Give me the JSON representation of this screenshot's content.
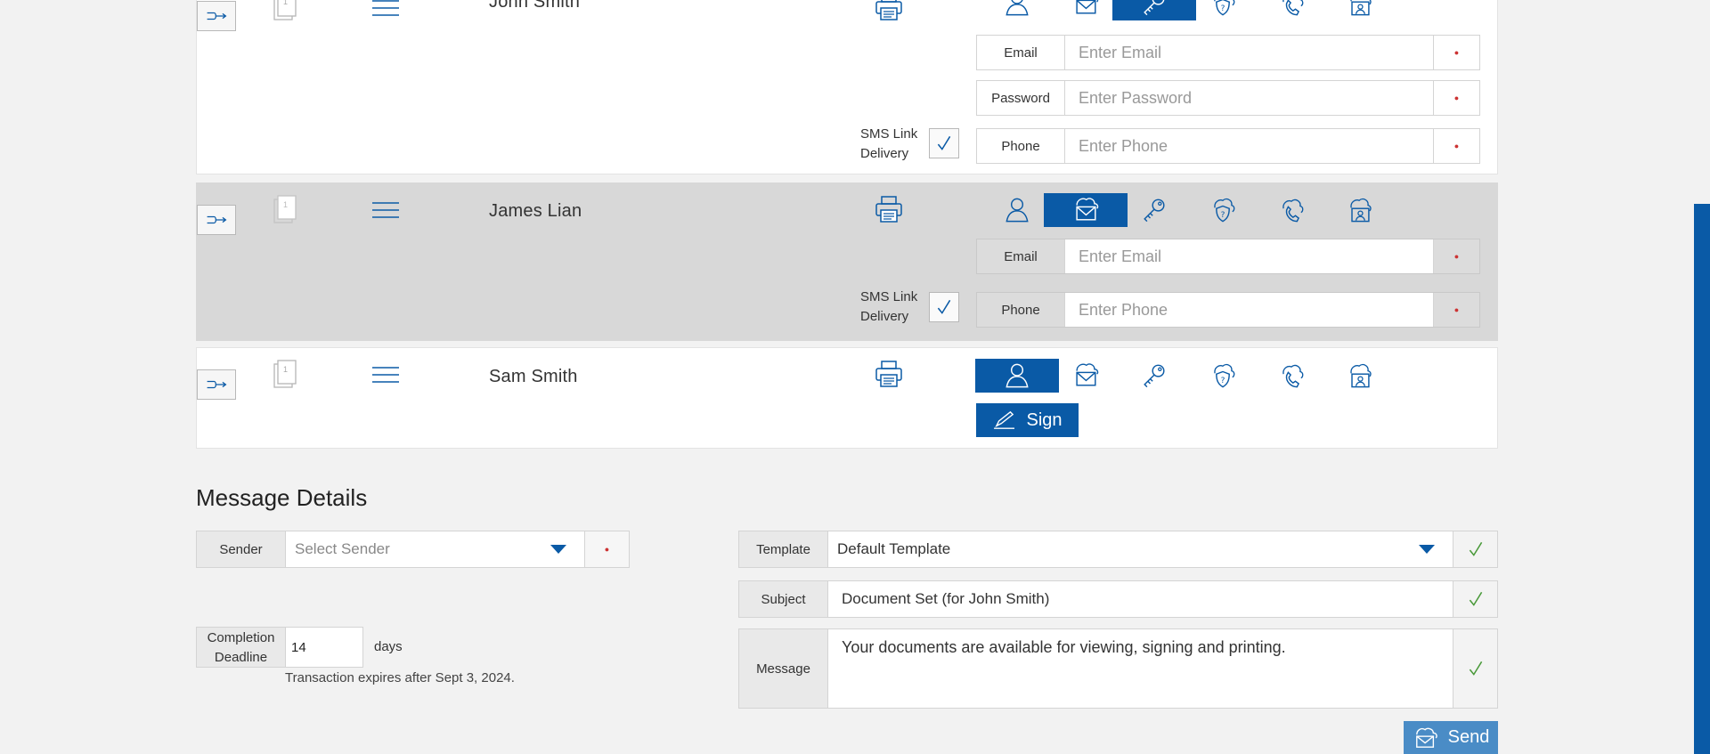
{
  "colors": {
    "accent": "#0a5aa6",
    "page_bg": "#f2f2f2",
    "row_shaded": "#d8d8d8",
    "required": "#cc3333",
    "valid": "#4a9a3a",
    "send_bg": "#4a8cc6"
  },
  "icons": {
    "route": "route-arrow-icon",
    "document": "document-icon",
    "menu": "hamburger-menu-icon",
    "print": "printer-icon",
    "auth_methods": [
      "user-icon",
      "email-icon",
      "key-icon",
      "shield-question-icon",
      "phone-icon",
      "id-card-icon"
    ]
  },
  "recipients": [
    {
      "name": "John Smith",
      "doc_number": "1",
      "active_auth": "key",
      "fields": [
        {
          "label": "Email",
          "placeholder": "Enter Email"
        },
        {
          "label": "Password",
          "placeholder": "Enter Password"
        },
        {
          "label": "Phone",
          "placeholder": "Enter Phone"
        }
      ],
      "sms_label_line1": "SMS Link",
      "sms_label_line2": "Delivery",
      "sms_checked": true
    },
    {
      "name": "James Lian",
      "doc_number": "1",
      "active_auth": "email",
      "fields": [
        {
          "label": "Email",
          "placeholder": "Enter Email"
        },
        {
          "label": "Phone",
          "placeholder": "Enter Phone"
        }
      ],
      "sms_label_line1": "SMS Link",
      "sms_label_line2": "Delivery",
      "sms_checked": true
    },
    {
      "name": "Sam Smith",
      "doc_number": "1",
      "active_auth": "user",
      "sign_label": "Sign"
    }
  ],
  "message_details": {
    "title": "Message Details",
    "sender_label": "Sender",
    "sender_placeholder": "Select Sender",
    "template_label": "Template",
    "template_value": "Default Template",
    "subject_label": "Subject",
    "subject_value": "Document Set (for John Smith)",
    "message_label": "Message",
    "message_value": "Your documents are available for viewing, signing and printing.",
    "deadline_label_line1": "Completion",
    "deadline_label_line2": "Deadline",
    "deadline_value": "14",
    "deadline_unit": "days",
    "expires_text": "Transaction expires after Sept 3, 2024.",
    "send_label": "Send"
  }
}
